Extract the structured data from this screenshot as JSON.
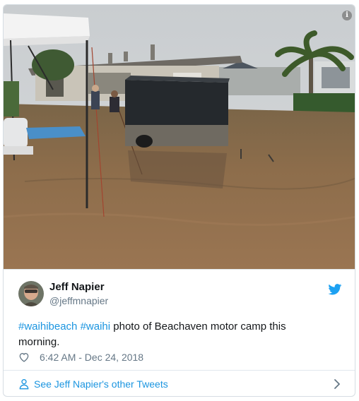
{
  "tweet": {
    "author_name": "Jeff Napier",
    "author_handle": "@jeffmnapier",
    "hashtag_1": "#waihibeach",
    "hashtag_2": "#waihi",
    "text_rest": " photo of Beachaven motor camp this morning.",
    "timestamp": "6:42 AM - Dec 24, 2018"
  },
  "footer": {
    "link_label": "See Jeff Napier's other Tweets"
  },
  "icons": {
    "info": "info-icon",
    "bird": "twitter-bird-icon",
    "like": "heart-icon",
    "person": "person-icon",
    "more": "chevron-right-icon"
  },
  "colors": {
    "brand_blue": "#1da1f2",
    "link_blue": "#1b95e0",
    "muted_text": "#657786",
    "border": "#e1e8ed",
    "floodwater": "#8a6a45"
  }
}
